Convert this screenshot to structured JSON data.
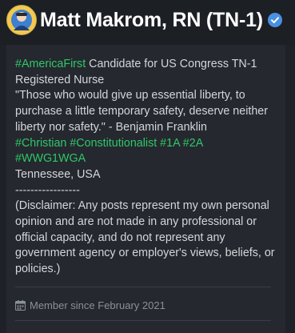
{
  "profile": {
    "name": "Matt Makrom, RN (TN-1)",
    "verified": true
  },
  "bio": {
    "line1_tag": "#AmericaFirst",
    "line1_rest": " Candidate for US Congress TN-1",
    "line2": "Registered Nurse",
    "quote": "\"Those who would give up essential liberty, to purchase a little temporary safety, deserve neither liberty nor safety.\" - Benjamin Franklin",
    "tags_line1": "#Christian #Constitutionalist #1A #2A",
    "tags_line2": "#WWG1WGA",
    "location": "Tennessee, USA",
    "separator": "-----------------",
    "disclaimer": "(Disclaimer: Any posts represent my own personal opinion and are not made in any professional or official capacity, and do not represent any government agency or employer's views, beliefs, or policies.)"
  },
  "member_since": "Member since February 2021",
  "colors": {
    "hashtag": "#2fc76b",
    "verified": "#4a90e2",
    "background": "#1e2127"
  },
  "icons": [
    "avatar-icon",
    "verified-check-icon",
    "calendar-icon"
  ]
}
